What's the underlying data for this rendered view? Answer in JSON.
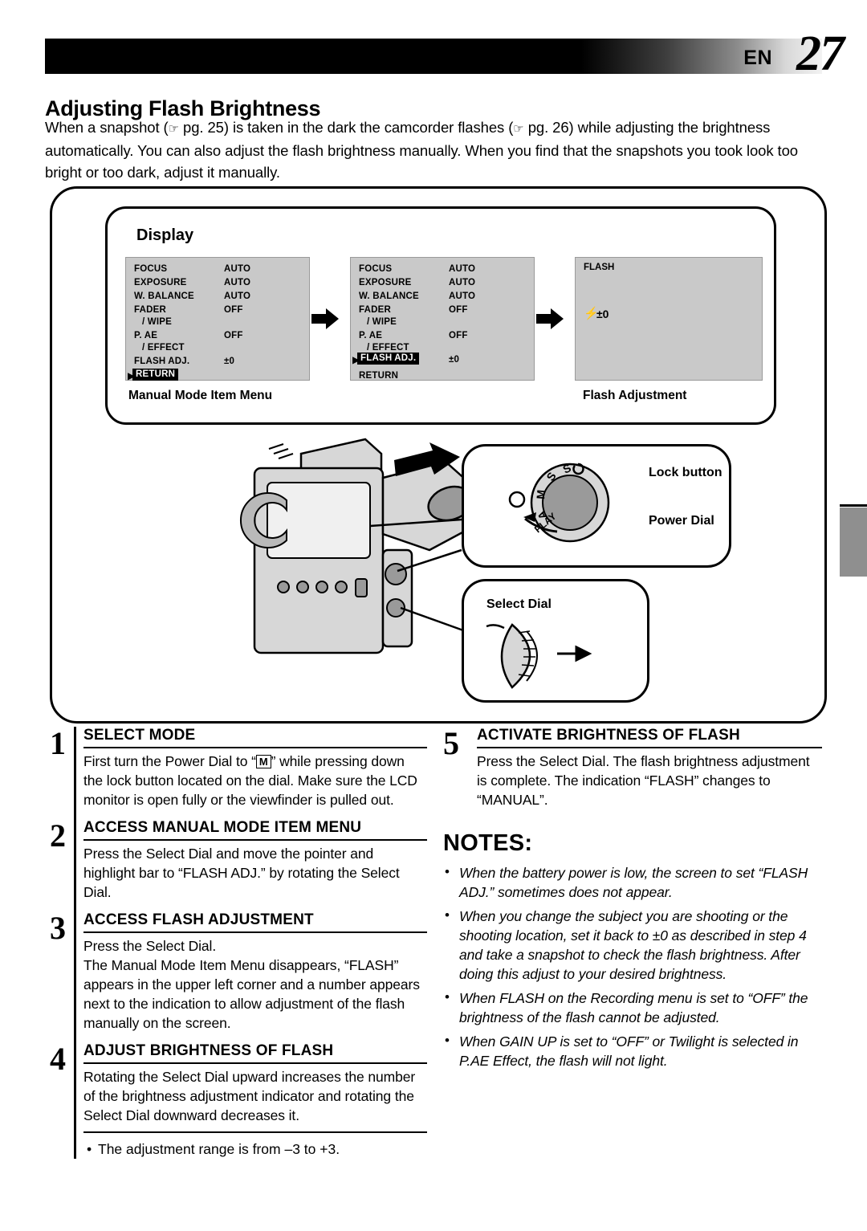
{
  "header": {
    "en_label": "EN",
    "page_number": "27"
  },
  "title": "Adjusting Flash Brightness",
  "intro": {
    "part1": "When a snapshot (",
    "ref1": "pg. 25",
    "part2": ") is taken in the dark the camcorder flashes (",
    "ref2": "pg. 26",
    "part3": ") while adjusting the brightness automatically. You can also adjust the flash brightness manually. When you find that the snapshots you took look too bright or too dark, adjust it manually."
  },
  "display_panel": {
    "label": "Display",
    "screen1": {
      "rows": [
        {
          "name": "FOCUS",
          "value": "AUTO"
        },
        {
          "name": "EXPOSURE",
          "value": "AUTO"
        },
        {
          "name": "W. BALANCE",
          "value": "AUTO"
        },
        {
          "name": "FADER",
          "value": "OFF"
        },
        {
          "name": "/ WIPE",
          "value": ""
        },
        {
          "name": "P. AE",
          "value": "OFF"
        },
        {
          "name": "/ EFFECT",
          "value": ""
        },
        {
          "name": "FLASH ADJ.",
          "value": "±0"
        }
      ],
      "return_label": "RETURN",
      "highlight": "return"
    },
    "screen2": {
      "rows": [
        {
          "name": "FOCUS",
          "value": "AUTO"
        },
        {
          "name": "EXPOSURE",
          "value": "AUTO"
        },
        {
          "name": "W. BALANCE",
          "value": "AUTO"
        },
        {
          "name": "FADER",
          "value": "OFF"
        },
        {
          "name": "/ WIPE",
          "value": ""
        },
        {
          "name": "P. AE",
          "value": "OFF"
        },
        {
          "name": "/ EFFECT",
          "value": ""
        },
        {
          "name": "FLASH ADJ.",
          "value": "±0"
        }
      ],
      "return_label": "RETURN",
      "highlight": "flash_adj"
    },
    "screen3": {
      "flash_label": "FLASH",
      "value": "±0"
    },
    "caption_left": "Manual Mode Item Menu",
    "caption_right": "Flash Adjustment"
  },
  "callouts": {
    "lock_button": "Lock button",
    "power_dial": "Power Dial",
    "select_dial": "Select Dial",
    "dial_positions": [
      "S",
      "S",
      "M",
      "A",
      "PLAY"
    ]
  },
  "steps": [
    {
      "num": "1",
      "head": "SELECT MODE",
      "body_pre": "First turn the Power Dial to “",
      "body_glyph": "M",
      "body_post": "” while pressing down the lock button located on the dial. Make sure the LCD monitor is open fully or the viewfinder is pulled out."
    },
    {
      "num": "2",
      "head": "ACCESS MANUAL MODE ITEM MENU",
      "body": "Press the Select Dial and move the pointer and highlight bar to “FLASH ADJ.” by rotating the Select Dial."
    },
    {
      "num": "3",
      "head": "ACCESS FLASH ADJUSTMENT",
      "body": "Press the Select Dial.\nThe Manual Mode Item Menu disappears, “FLASH” appears in the upper left corner and a number appears next to the indication to allow adjustment of the flash manually on the screen."
    },
    {
      "num": "4",
      "head": "ADJUST BRIGHTNESS OF FLASH",
      "body": "Rotating the Select Dial upward increases the number of the brightness adjustment indicator and rotating the Select Dial downward decreases it."
    },
    {
      "num": "5",
      "head": "ACTIVATE BRIGHTNESS OF FLASH",
      "body": "Press the Select Dial. The flash brightness adjustment is complete. The indication “FLASH” changes to “MANUAL”."
    }
  ],
  "range_note": "The adjustment range is from –3 to +3.",
  "notes": {
    "title": "NOTES:",
    "items": [
      "When the battery power is low, the screen to set “FLASH ADJ.” sometimes does not appear.",
      "When you change the subject you are shooting or the shooting location, set it back to ±0 as described in step 4 and take a snapshot to check the flash brightness. After doing this adjust to your desired brightness.",
      "When FLASH on the Recording menu is set to “OFF” the brightness of the flash cannot be adjusted.",
      "When GAIN UP is set to “OFF” or Twilight is selected in P.AE Effect, the flash will not light."
    ]
  }
}
